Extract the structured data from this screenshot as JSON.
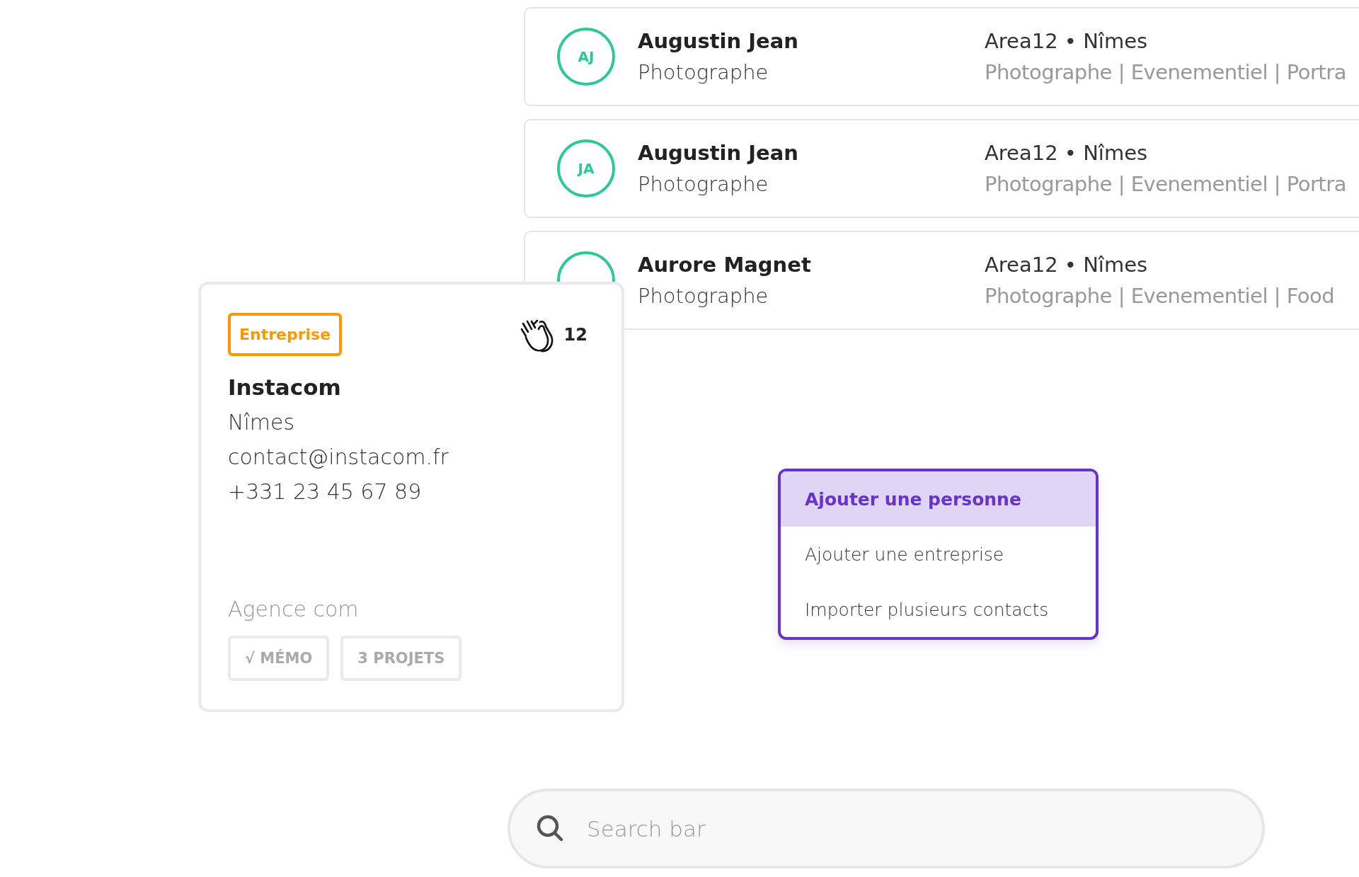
{
  "contacts": [
    {
      "initials": "AJ",
      "name": "Augustin Jean",
      "role": "Photographe",
      "location": "Area12 • Nîmes",
      "tags": "Photographe | Evenementiel | Portra"
    },
    {
      "initials": "JA",
      "name": "Augustin Jean",
      "role": "Photographe",
      "location": "Area12 • Nîmes",
      "tags": "Photographe | Evenementiel | Portra"
    },
    {
      "name": "Aurore Magnet",
      "role": "Photographe",
      "location": "Area12 • Nîmes",
      "tags": "Photographe | Evenementiel | Food"
    }
  ],
  "company_card": {
    "badge": "Entreprise",
    "claps": "12",
    "name": "Instacom",
    "city": "Nîmes",
    "email": "contact@instacom.fr",
    "phone": "+331 23 45 67 89",
    "category": "Agence com",
    "buttons": [
      "√ MÉMO",
      "3 PROJETS"
    ]
  },
  "menu": {
    "items": [
      {
        "label": "Ajouter une personne",
        "selected": true
      },
      {
        "label": "Ajouter une entreprise",
        "selected": false
      },
      {
        "label": "Importer plusieurs contacts",
        "selected": false
      }
    ]
  },
  "search": {
    "placeholder": "Search bar"
  }
}
